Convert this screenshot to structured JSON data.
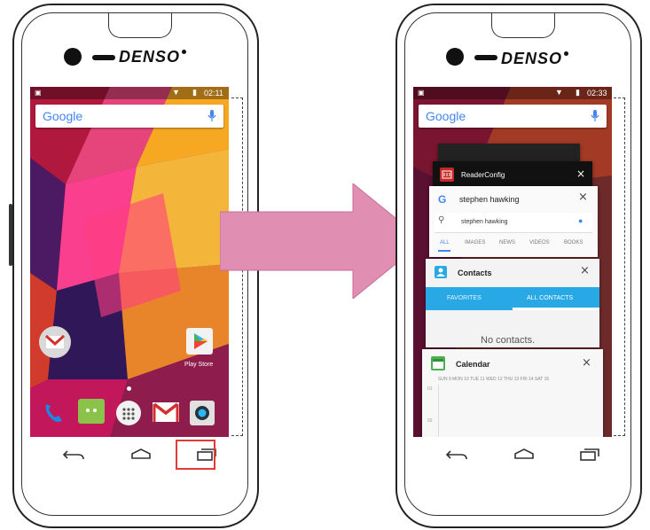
{
  "left_phone": {
    "brand": "DENSO",
    "status_time": "02:11",
    "search_label": "Google",
    "playstore_label": "Play Store"
  },
  "right_phone": {
    "brand": "DENSO",
    "status_time": "02:33",
    "search_label": "Google",
    "recent_apps": {
      "reader_config": "ReaderConfig",
      "google_card_title": "stephen hawking",
      "google_query": "stephen hawking",
      "google_tabs": [
        "ALL",
        "IMAGES",
        "NEWS",
        "VIDEOS",
        "BOOKS"
      ],
      "contacts_title": "Contacts",
      "contacts_tabs": [
        "FAVORITES",
        "ALL CONTACTS"
      ],
      "contacts_empty": "No contacts.",
      "calendar_title": "Calendar",
      "calendar_days": "SUN 9   MON 10   TUE 11   WED 12   THU 13   FRI 14   SAT 15",
      "calendar_rows": [
        "01",
        "02"
      ]
    }
  },
  "colors": {
    "arrow": "#e08fb3",
    "highlight": "#e53935",
    "contacts_bar": "#29a8e6"
  }
}
